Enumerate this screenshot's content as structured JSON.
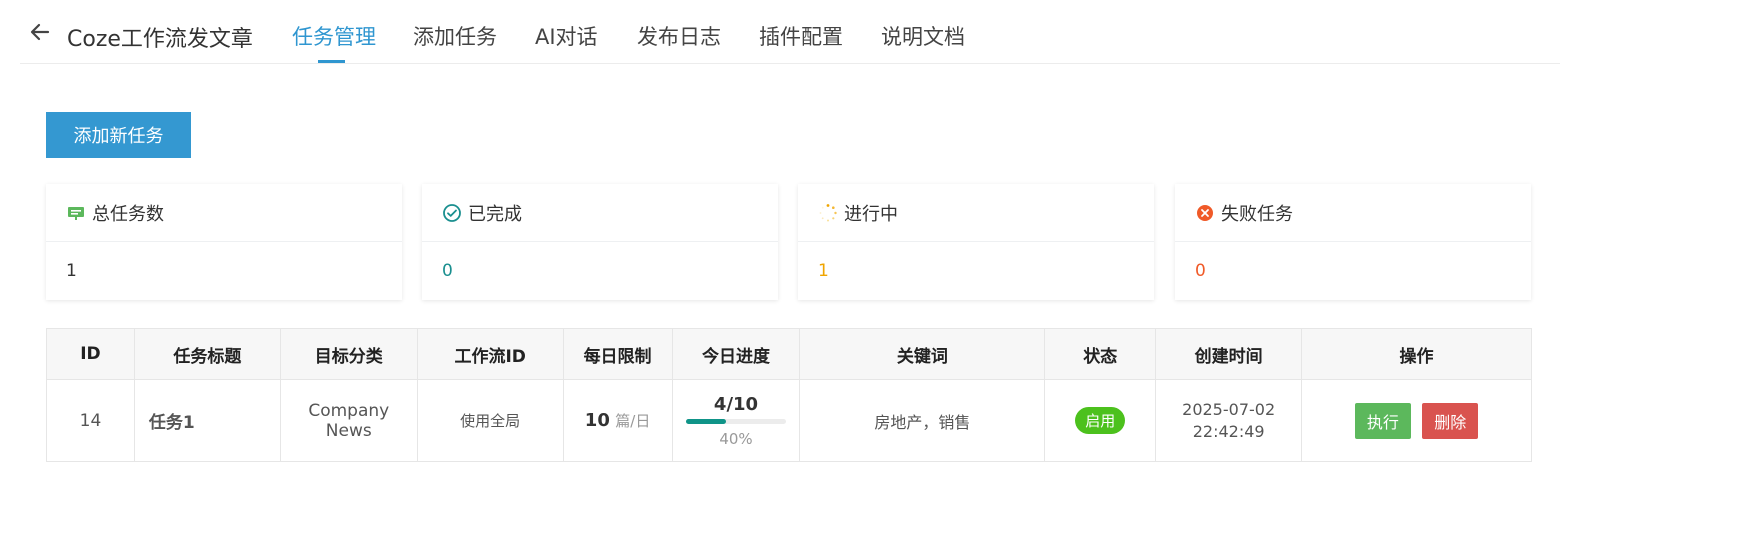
{
  "header": {
    "title": "Coze工作流发文章",
    "tabs": [
      {
        "label": "任务管理",
        "active": true
      },
      {
        "label": "添加任务"
      },
      {
        "label": "AI对话"
      },
      {
        "label": "发布日志"
      },
      {
        "label": "插件配置"
      },
      {
        "label": "说明文档"
      }
    ]
  },
  "actions": {
    "add_task_label": "添加新任务"
  },
  "stats": [
    {
      "label": "总任务数",
      "value": "1",
      "icon": "task-board-icon",
      "color": "#333333"
    },
    {
      "label": "已完成",
      "value": "0",
      "icon": "check-circle-icon",
      "color": "#1a8f8f"
    },
    {
      "label": "进行中",
      "value": "1",
      "icon": "loading-spinner-icon",
      "color": "#f0a500"
    },
    {
      "label": "失败任务",
      "value": "0",
      "icon": "error-circle-icon",
      "color": "#f05a28"
    }
  ],
  "table": {
    "columns": [
      "ID",
      "任务标题",
      "目标分类",
      "工作流ID",
      "每日限制",
      "今日进度",
      "关键词",
      "状态",
      "创建时间",
      "操作"
    ],
    "rows": [
      {
        "id": "14",
        "title": "任务1",
        "category": "Company News",
        "workflow_id": "使用全局",
        "daily_limit": "10",
        "daily_limit_unit": "篇/日",
        "progress_text": "4/10",
        "progress_fraction": 0.4,
        "progress_percent": "40%",
        "keywords": "房地产，销售",
        "status": "启用",
        "created_at": "2025-07-02 22:42:49",
        "execute_label": "执行",
        "delete_label": "删除"
      }
    ]
  },
  "colors": {
    "accent": "#2f96d0",
    "status_enabled": "#4cc11d",
    "execute": "#5cb85c",
    "delete": "#d9534f"
  }
}
